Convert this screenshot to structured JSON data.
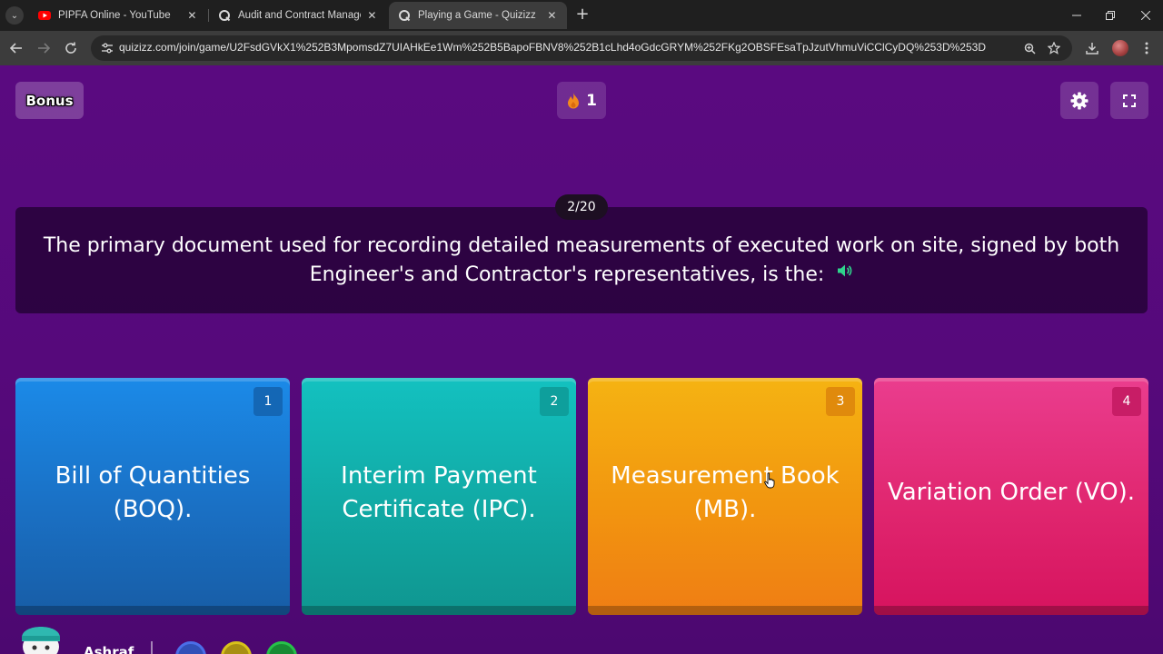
{
  "browser": {
    "tabs": [
      {
        "title": "PIPFA Online - YouTube",
        "favicon": "youtube-icon",
        "active": false
      },
      {
        "title": "Audit and Contract Management",
        "favicon": "quizizz-icon",
        "active": false
      },
      {
        "title": "Playing a Game - Quizizz",
        "favicon": "quizizz-icon",
        "active": true
      }
    ],
    "close_glyph": "✕",
    "new_tab_glyph": "+",
    "url": "quizizz.com/join/game/U2FsdGVkX1%252B3MpomsdZ7UIAHkEe1Wm%252B5BapoFBNV8%252B1cLhd4oGdcGRYM%252FKg2OBSFEsaTpJzutVhmuViCClCyDQ%253D%253D"
  },
  "game": {
    "bonus_label": "Bonus",
    "streak_count": "1",
    "question_counter": "2/20",
    "question_text": "The primary document used for recording detailed measurements of executed work on site, signed by both Engineer's and Contractor's representatives, is the:",
    "options": [
      {
        "number": "1",
        "text": "Bill of Quantities (BOQ)."
      },
      {
        "number": "2",
        "text": "Interim Payment Certificate (IPC)."
      },
      {
        "number": "3",
        "text": "Measurement Book (MB)."
      },
      {
        "number": "4",
        "text": "Variation Order (VO)."
      }
    ],
    "player_name": "Ashraf"
  },
  "colors": {
    "background": "#55097a",
    "option_1": "#1a70c4",
    "option_2": "#11a9a4",
    "option_3": "#f2950f",
    "option_4": "#e0266f"
  }
}
